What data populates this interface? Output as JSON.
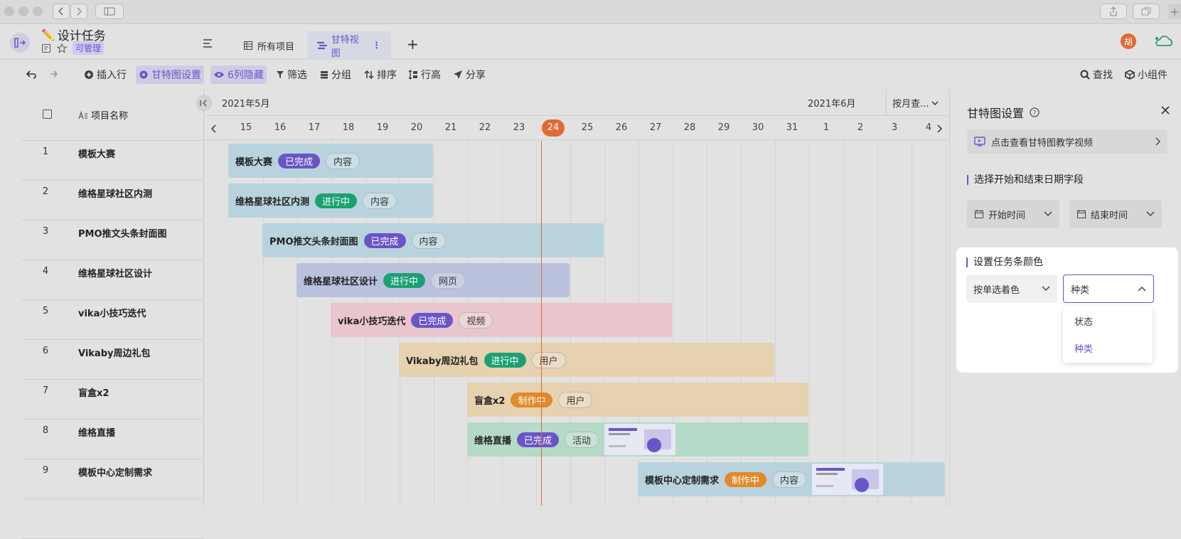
{
  "app": {
    "title": "设计任务",
    "permission": "可管理",
    "avatar_text": "胡"
  },
  "tabs": [
    {
      "label": "所有项目"
    },
    {
      "label": "甘特视图"
    }
  ],
  "toolbar": {
    "insert_row": "插入行",
    "gantt_settings": "甘特图设置",
    "hidden_cols": "6列隐藏",
    "filter": "筛选",
    "group": "分组",
    "sort": "排序",
    "row_height": "行高",
    "share": "分享",
    "find": "查找",
    "widget": "小组件"
  },
  "grid": {
    "column_header": "项目名称",
    "rows": [
      {
        "num": "1",
        "name": "模板大赛"
      },
      {
        "num": "2",
        "name": "维格星球社区内测"
      },
      {
        "num": "3",
        "name": "PMO推文头条封面图"
      },
      {
        "num": "4",
        "name": "维格星球社区设计"
      },
      {
        "num": "5",
        "name": "vika小技巧迭代"
      },
      {
        "num": "6",
        "name": "Vikaby周边礼包"
      },
      {
        "num": "7",
        "name": "盲盒x2"
      },
      {
        "num": "8",
        "name": "维格直播"
      },
      {
        "num": "9",
        "name": "模板中心定制需求"
      }
    ]
  },
  "timeline": {
    "month_may": "2021年5月",
    "month_jun": "2021年6月",
    "scale_select": "按月查...",
    "days": [
      "15",
      "16",
      "17",
      "18",
      "19",
      "20",
      "21",
      "22",
      "23",
      "24",
      "25",
      "26",
      "27",
      "28",
      "29",
      "30",
      "31",
      "1",
      "2",
      "3",
      "4"
    ],
    "today": "24"
  },
  "tasks": [
    {
      "title": "模板大赛",
      "status": "已完成",
      "status_kind": "done",
      "type": "内容",
      "color": "#b9d3de"
    },
    {
      "title": "维格星球社区内测",
      "status": "进行中",
      "status_kind": "prog",
      "type": "内容",
      "color": "#b9d3de"
    },
    {
      "title": "PMO推文头条封面图",
      "status": "已完成",
      "status_kind": "done",
      "type": "内容",
      "color": "#b9d3de"
    },
    {
      "title": "维格星球社区设计",
      "status": "进行中",
      "status_kind": "prog",
      "type": "网页",
      "color": "#bac1dd"
    },
    {
      "title": "vika小技巧迭代",
      "status": "已完成",
      "status_kind": "done",
      "type": "视频",
      "color": "#e9c5cd"
    },
    {
      "title": "Vikaby周边礼包",
      "status": "进行中",
      "status_kind": "prog",
      "type": "用户",
      "color": "#e6d1b0"
    },
    {
      "title": "盲盒x2",
      "status": "制作中",
      "status_kind": "make",
      "type": "用户",
      "color": "#e6d1b0"
    },
    {
      "title": "维格直播",
      "status": "已完成",
      "status_kind": "done",
      "type": "活动",
      "color": "#b5dac8"
    },
    {
      "title": "模板中心定制需求",
      "status": "制作中",
      "status_kind": "make",
      "type": "内容",
      "color": "#b9d3de"
    }
  ],
  "panel": {
    "title": "甘特图设置",
    "tutorial": "点击查看甘特图教学视频",
    "date_section": "选择开始和结束日期字段",
    "start_field": "开始时间",
    "end_field": "结束时间",
    "color_section": "设置任务条颜色",
    "color_mode": "按单选着色",
    "color_field": "种类",
    "options": [
      "状态",
      "种类"
    ]
  },
  "colors": {
    "accent": "#6a55c8",
    "today_line": "#e06a32",
    "done": "#6a55c8",
    "in_progress": "#1ca073",
    "making": "#e08a2c"
  }
}
